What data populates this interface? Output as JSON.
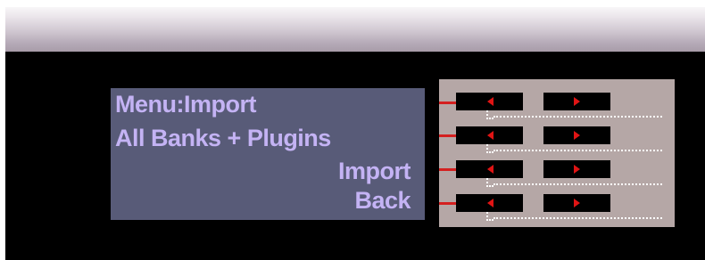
{
  "display": {
    "lines": [
      "Menu:Import",
      "All Banks + Plugins",
      "Import",
      "Back"
    ]
  },
  "buttons": [
    {
      "left_icon": "arrow-left-icon",
      "right_icon": "arrow-right-icon"
    },
    {
      "left_icon": "arrow-left-icon",
      "right_icon": "arrow-right-icon"
    },
    {
      "left_icon": "arrow-left-icon",
      "right_icon": "arrow-right-icon"
    },
    {
      "left_icon": "arrow-left-icon",
      "right_icon": "arrow-right-icon"
    }
  ],
  "colors": {
    "lcd_background": "#585b78",
    "lcd_text": "#c4b3f4",
    "panel": "#b5a7a6",
    "arrow": "#e01414",
    "indicator_line": "#d42020"
  }
}
